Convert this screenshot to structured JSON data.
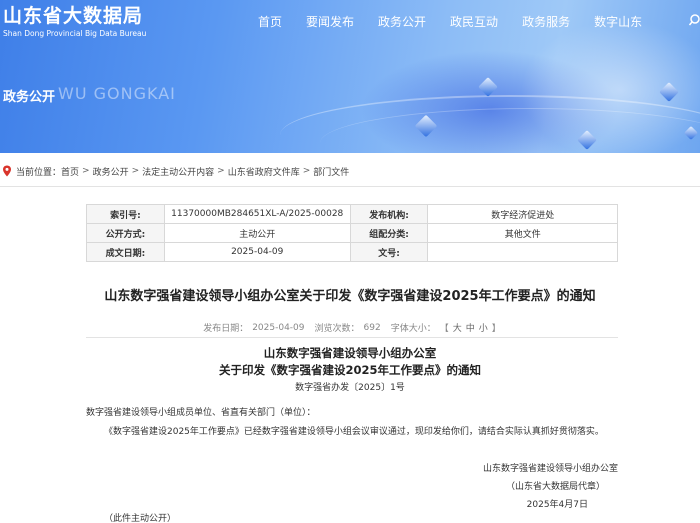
{
  "header": {
    "logo_cn": "山东省大数据局",
    "logo_en": "Shan Dong Provincial Big Data Bureau",
    "nav": [
      "首页",
      "要闻发布",
      "政务公开",
      "政民互动",
      "政务服务",
      "数字山东"
    ],
    "section_cn": "政务公开",
    "section_en": "WU GONGKAI",
    "colors": {
      "banner_primary": "#3f7fe8",
      "banner_light": "#9fc9f7"
    }
  },
  "breadcrumb": {
    "label": "当前位置：",
    "items": [
      "首页",
      "政务公开",
      "法定主动公开内容",
      "山东省政府文件库",
      "部门文件"
    ],
    "separator": ">"
  },
  "meta": {
    "rows": [
      [
        {
          "k": "索引号:",
          "v": "11370000MB284651XL-A/2025-00028"
        },
        {
          "k": "发布机构:",
          "v": "数字经济促进处"
        }
      ],
      [
        {
          "k": "公开方式:",
          "v": "主动公开"
        },
        {
          "k": "组配分类:",
          "v": "其他文件"
        }
      ],
      [
        {
          "k": "成文日期:",
          "v": "2025-04-09"
        },
        {
          "k": "文号:",
          "v": ""
        }
      ]
    ]
  },
  "article": {
    "title": "山东数字强省建设领导小组办公室关于印发《数字强省建设2025年工作要点》的通知",
    "publish_label": "发布日期：",
    "publish_date": "2025-04-09",
    "views_label": "浏览次数：",
    "views": "692",
    "font_label": "字体大小：",
    "font_open": "【",
    "font_sizes": [
      "大",
      "中",
      "小"
    ],
    "font_close": "】",
    "header_line1": "山东数字强省建设领导小组办公室",
    "header_line2": "关于印发《数字强省建设2025年工作要点》的通知",
    "doc_number": "数字强省办发〔2025〕1号",
    "salutation": "数字强省建设领导小组成员单位、省直有关部门（单位）：",
    "paragraph": "《数字强省建设2025年工作要点》已经数字强省建设领导小组会议审议通过，现印发给你们，请结合实际认真抓好贯彻落实。",
    "sign_org": "山东数字强省建设领导小组办公室",
    "sign_note": "（山东省大数据局代章）",
    "sign_date": "2025年4月7日",
    "footer_note": "（此件主动公开）"
  }
}
